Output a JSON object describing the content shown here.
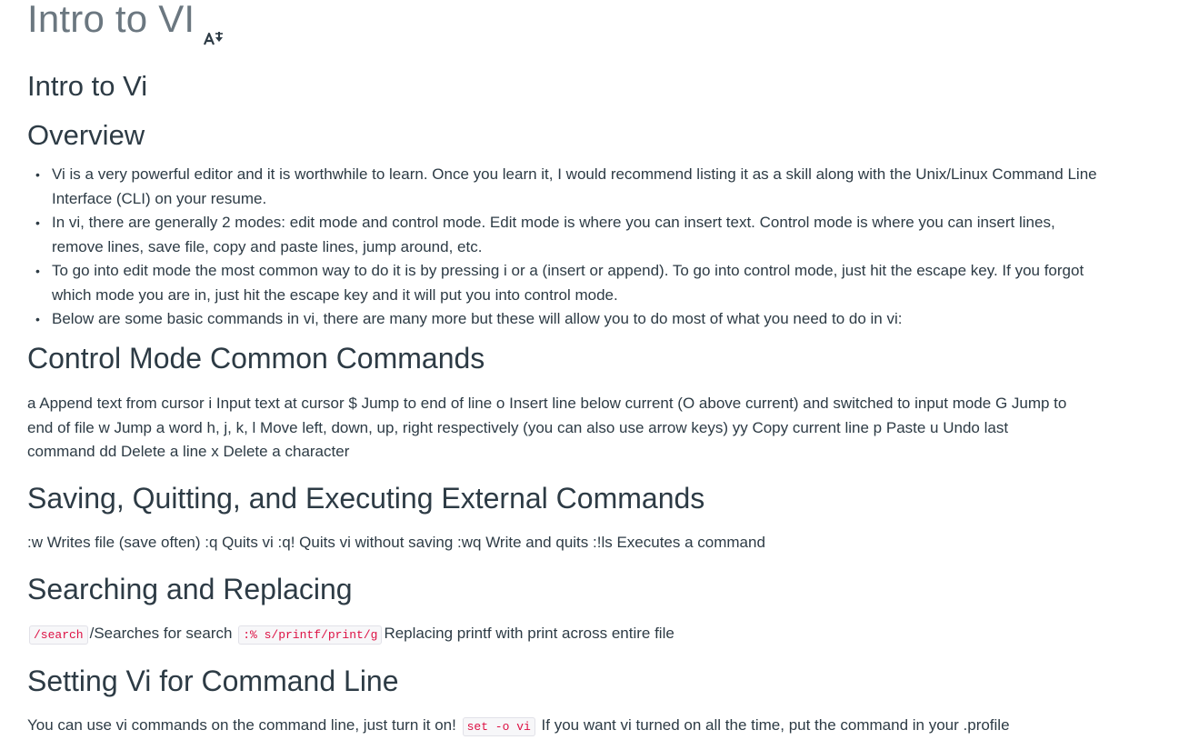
{
  "page": {
    "title": "Intro to VI"
  },
  "sections": {
    "intro_heading": "Intro to Vi",
    "overview_heading": "Overview",
    "overview_items": [
      "Vi is a very powerful editor and it is worthwhile to learn. Once you learn it, I would recommend listing it as a skill along with the Unix/Linux Command Line Interface (CLI) on your resume.",
      "In vi, there are generally 2 modes: edit mode and control mode. Edit mode is where you can insert text. Control mode is where you can insert lines, remove lines, save file, copy and paste lines, jump around, etc.",
      "To go into edit mode the most common way to do it is by pressing i or a (insert or append). To go into control mode, just hit the escape key. If you forgot which mode you are in, just hit the escape key and it will put you into control mode.",
      "Below are some basic commands in vi, there are many more but these will allow you to do most of what you need to do in vi:"
    ],
    "control_heading": "Control Mode Common Commands",
    "control_text": "a Append text from cursor i Input text at cursor $ Jump to end of line o Insert line below current (O above current) and switched to input mode G Jump to end of file w Jump a word h, j, k, l Move left, down, up, right respectively (you can also use arrow keys) yy Copy current line p Paste u Undo last command dd Delete a line x Delete a character",
    "saving_heading": "Saving, Quitting, and Executing External Commands",
    "saving_text": ":w Writes file (save often) :q Quits vi :q! Quits vi without saving :wq Write and quits :!ls Executes a command",
    "search_heading": "Searching and Replacing",
    "search_code_1": "/search",
    "search_text_1": "/Searches for search",
    "search_code_2": ":% s/printf/print/g",
    "search_text_2": "Replacing printf with print across entire file",
    "setting_heading": "Setting Vi for Command Line",
    "setting_text_1": "You can use vi commands on the command line, just turn it on!",
    "setting_code": "set -o vi",
    "setting_text_2": "If you want vi turned on all the time, put the command in your .profile"
  },
  "icons": {
    "title_icon": "immersive-reader-icon"
  },
  "colors": {
    "title": "#6b7780",
    "text": "#2d3b45",
    "code_text": "#dd1144",
    "code_bg": "#f7f7f9"
  }
}
